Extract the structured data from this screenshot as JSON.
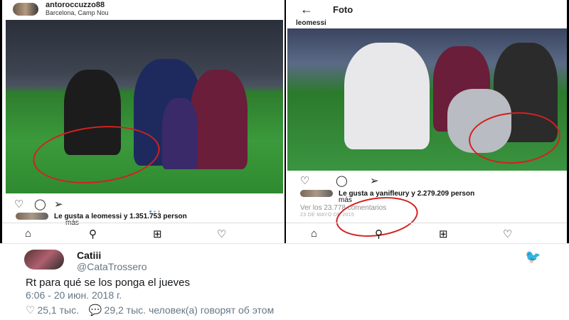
{
  "left_post": {
    "username": "antoroccuzzo88",
    "location": "Barcelona, Camp Nou",
    "likes_text": "Le gusta a leomessi y 1.351.753 person",
    "likes_more": "más"
  },
  "right_post": {
    "header_title": "Foto",
    "username": "leomessi",
    "likes_text": "Le gusta a yanifleury y 2.279.209 person",
    "likes_more": "más",
    "comments_link": "Ver los 23.778 comentarios",
    "date": "23 DE MAYO DE 2015"
  },
  "tweet": {
    "display_name": "Catiii",
    "handle": "@CataTrossero",
    "text": "Rt para qué se los ponga el jueves",
    "timestamp": "6:06 - 20 июн. 2018 г.",
    "likes": "25,1 тыс.",
    "replies_text": "29,2 тыс. человек(а) говорят об этом"
  },
  "colors": {
    "annotation_red": "#d42020",
    "twitter_blue": "#1da1f2",
    "active_dot": "#3897f0"
  },
  "icons": [
    "heart-icon",
    "comment-icon",
    "share-icon",
    "home-icon",
    "search-icon",
    "add-post-icon",
    "activity-heart-icon",
    "back-arrow-icon",
    "twitter-bird-icon"
  ]
}
